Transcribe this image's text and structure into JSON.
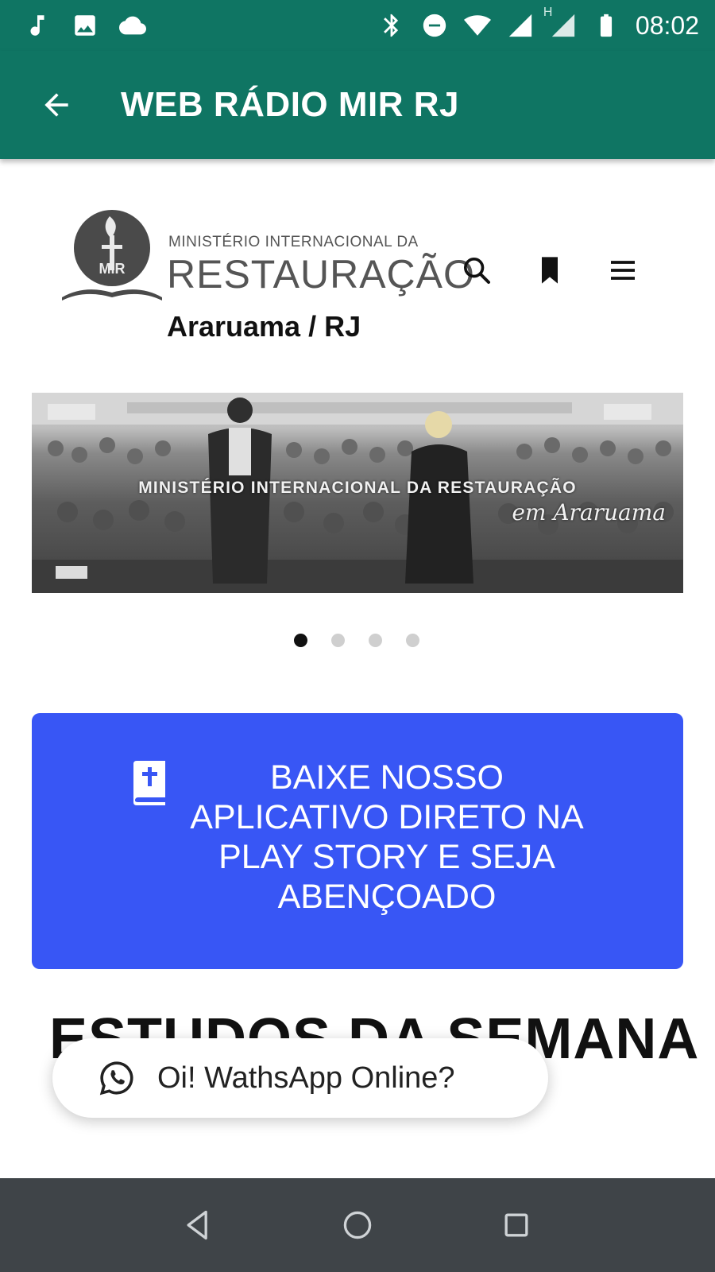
{
  "status_bar": {
    "time": "08:02",
    "left_icons": [
      "music-note-icon",
      "image-icon",
      "cloud-icon"
    ],
    "right_icons": [
      "bluetooth-icon",
      "do-not-disturb-icon",
      "wifi-icon",
      "signal-icon",
      "signal-h-icon",
      "battery-icon"
    ],
    "network_label": "H"
  },
  "app_bar": {
    "title": "WEB RÁDIO MIR RJ",
    "back_icon": "arrow-back-icon",
    "background": "#0f7563"
  },
  "site_header": {
    "logo_small": "MINISTÉRIO INTERNACIONAL DA",
    "logo_big": "RESTAURAÇÃO",
    "logo_city": "Araruama / RJ",
    "logo_emblem_text": "MIR",
    "icons": [
      "search-icon",
      "bookmark-icon",
      "menu-icon"
    ]
  },
  "carousel": {
    "title": "MINISTÉRIO INTERNACIONAL DA RESTAURAÇÃO",
    "subtitle": "em Araruama",
    "slide_count": 4,
    "active_index": 0
  },
  "download_banner": {
    "icon": "bible-icon",
    "text": "BAIXE NOSSO APLICATIVO DIRETO NA PLAY STORY E SEJA ABENÇOADO",
    "background": "#3856f5"
  },
  "section": {
    "heading": "ESTUDOS DA SEMANA"
  },
  "whatsapp": {
    "icon": "whatsapp-icon",
    "label": "Oi! WathsApp Online?"
  },
  "nav_bar": {
    "buttons": [
      "back-nav-icon",
      "home-nav-icon",
      "recents-nav-icon"
    ]
  }
}
